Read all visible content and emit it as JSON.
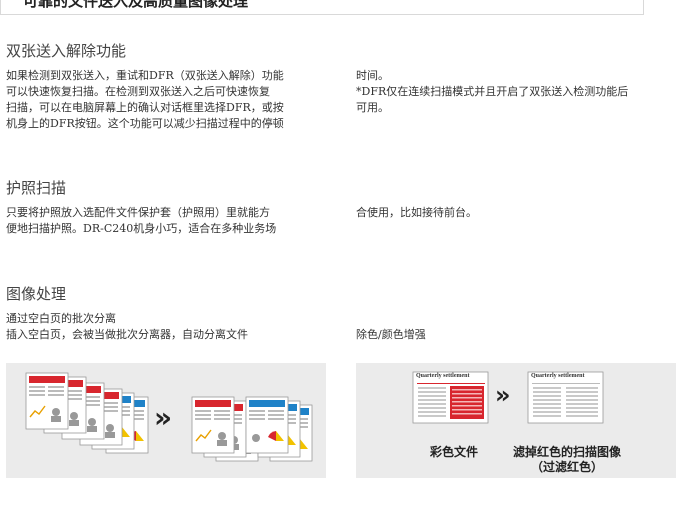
{
  "header": {
    "title": "可靠的文件送入及高质量图像处理"
  },
  "sections": [
    {
      "heading": "双张送入解除功能",
      "left_lines": [
        "如果检测到双张送入，重试和DFR（双张送入解除）功能",
        "可以快速恢复扫描。在检测到双张送入之后可快速恢复",
        "扫描，可以在电脑屏幕上的确认对话框里选择DFR，或按",
        "机身上的DFR按钮。这个功能可以减少扫描过程中的停顿"
      ],
      "right_lines": [
        "时间。",
        "*DFR仅在连续扫描模式并且开启了双张送入检测功能后",
        "可用。"
      ]
    },
    {
      "heading": "护照扫描",
      "left_lines": [
        "只要将护照放入选配件文件保护套（护照用）里就能方",
        "便地扫描护照。DR-C240机身小巧，适合在多种业务场"
      ],
      "right_lines": [
        "合使用，比如接待前台。"
      ]
    },
    {
      "heading": "图像处理",
      "left_lines": [
        "通过空白页的批次分离",
        "插入空白页，会被当做批次分离器，自动分离文件"
      ],
      "right_lines": [
        "除色/颜色增强"
      ]
    }
  ],
  "figures": {
    "arrow_glyph": "»",
    "left_panel": {},
    "right_panel": {
      "doc_title": "Quarterly settlement",
      "caption_color": "彩色文件",
      "caption_filtered_line1": "滤掉红色的扫描图像",
      "caption_filtered_line2": "（过滤红色）"
    }
  },
  "colors": {
    "red": "#d8262e",
    "blue": "#1f82c8",
    "yellow": "#f2c200",
    "panel": "#ebebeb"
  }
}
